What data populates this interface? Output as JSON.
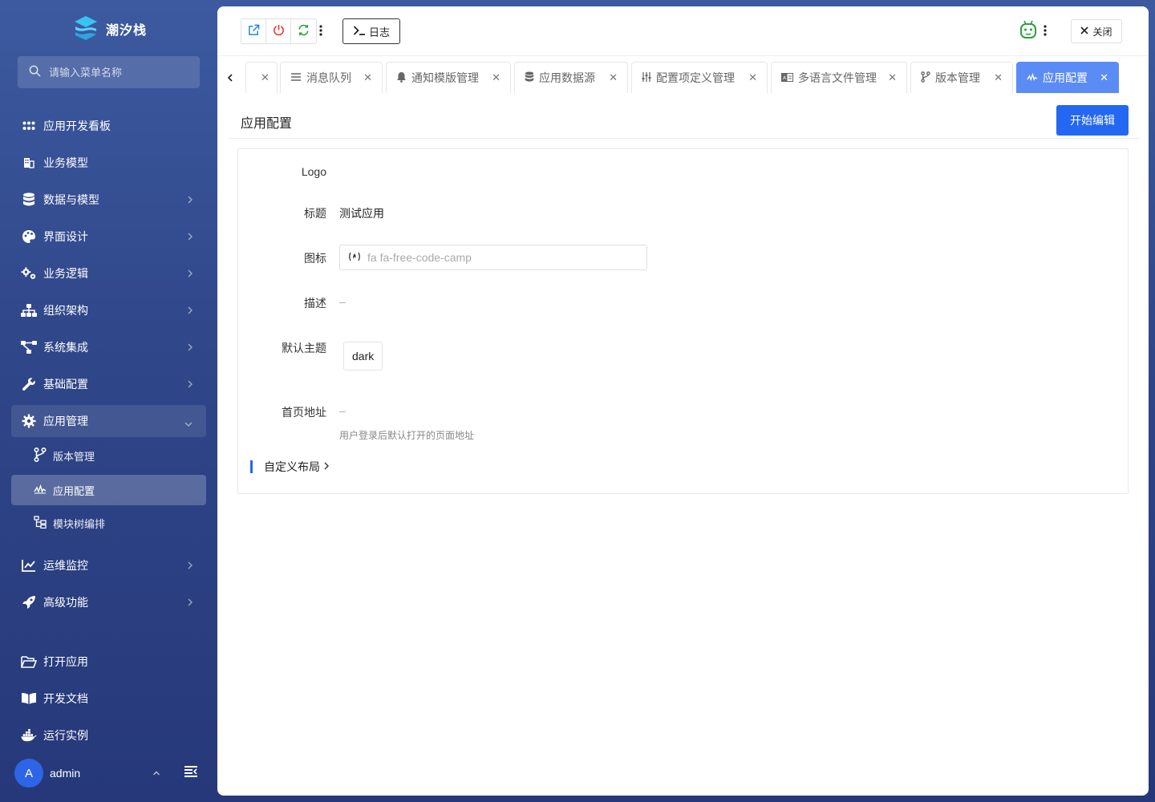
{
  "brand": {
    "name": "潮汐栈"
  },
  "search": {
    "placeholder": "请输入菜单名称"
  },
  "sidebar": {
    "items": [
      {
        "label": "应用开发看板"
      },
      {
        "label": "业务模型"
      },
      {
        "label": "数据与模型"
      },
      {
        "label": "界面设计"
      },
      {
        "label": "业务逻辑"
      },
      {
        "label": "组织架构"
      },
      {
        "label": "系统集成"
      },
      {
        "label": "基础配置"
      },
      {
        "label": "应用管理"
      },
      {
        "label": "运维监控"
      },
      {
        "label": "高级功能"
      }
    ],
    "sub_items": [
      {
        "label": "版本管理"
      },
      {
        "label": "应用配置"
      },
      {
        "label": "模块树编排"
      }
    ],
    "bottom_items": [
      {
        "label": "打开应用"
      },
      {
        "label": "开发文档"
      },
      {
        "label": "运行实例"
      }
    ]
  },
  "user": {
    "avatar_letter": "A",
    "name": "admin"
  },
  "toolbar": {
    "log_label": "日志",
    "close_label": "关闭"
  },
  "tabs": [
    {
      "label": ""
    },
    {
      "label": "消息队列"
    },
    {
      "label": "通知模版管理"
    },
    {
      "label": "应用数据源"
    },
    {
      "label": "配置项定义管理"
    },
    {
      "label": "多语言文件管理"
    },
    {
      "label": "版本管理"
    },
    {
      "label": "应用配置"
    }
  ],
  "page": {
    "title": "应用配置",
    "edit_button": "开始编辑"
  },
  "form": {
    "logo_label": "Logo",
    "title_label": "标题",
    "title_value": "测试应用",
    "icon_label": "图标",
    "icon_placeholder": "fa fa-free-code-camp",
    "desc_label": "描述",
    "desc_value": "–",
    "theme_label": "默认主题",
    "theme_value": "dark",
    "home_label": "首页地址",
    "home_value": "–",
    "home_hint": "用户登录后默认打开的页面地址",
    "layout_section": "自定义布局"
  },
  "colors": {
    "accent": "#2468f2",
    "active_tab": "#5b8cf5",
    "sidebar_top": "#3d5aa0",
    "sidebar_bottom": "#26387a"
  }
}
